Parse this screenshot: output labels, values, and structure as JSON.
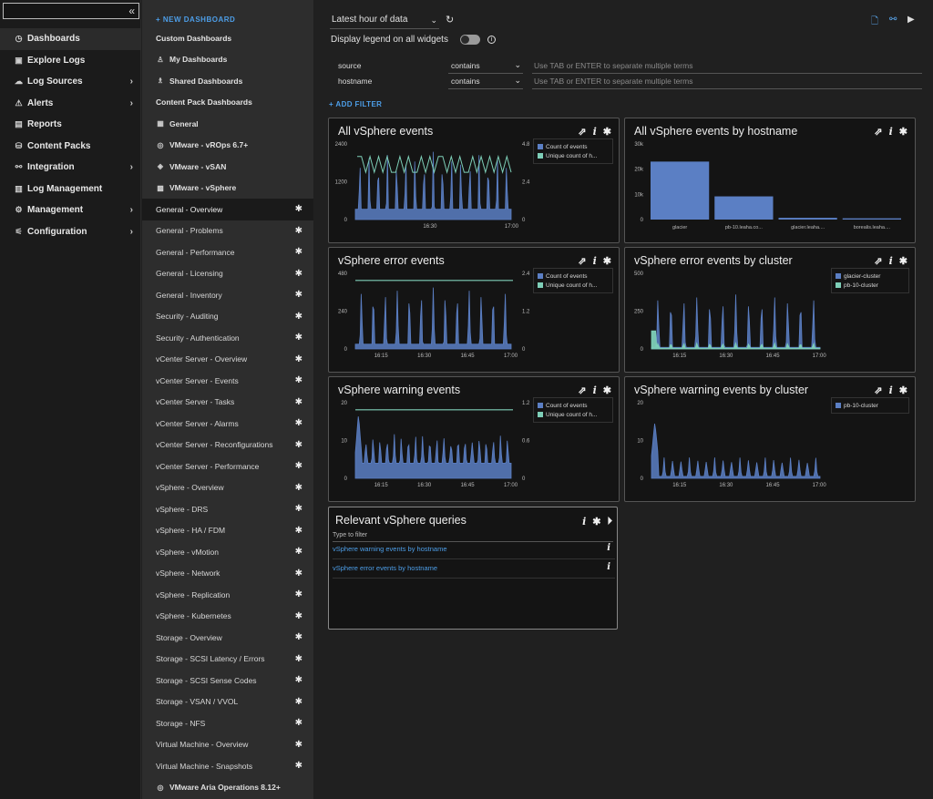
{
  "leftnav": {
    "search_value": "",
    "collapse_glyph": "«",
    "items": [
      {
        "label": "Dashboards",
        "icon": "dashboard-icon",
        "glyph": "◷",
        "active": true,
        "chevron": false
      },
      {
        "label": "Explore Logs",
        "icon": "explore-icon",
        "glyph": "▣",
        "active": false,
        "chevron": false
      },
      {
        "label": "Log Sources",
        "icon": "log-sources-icon",
        "glyph": "☁",
        "active": false,
        "chevron": true
      },
      {
        "label": "Alerts",
        "icon": "alert-icon",
        "glyph": "⚠",
        "active": false,
        "chevron": true
      },
      {
        "label": "Reports",
        "icon": "report-icon",
        "glyph": "▤",
        "active": false,
        "chevron": false
      },
      {
        "label": "Content Packs",
        "icon": "content-pack-icon",
        "glyph": "⛁",
        "active": false,
        "chevron": false
      },
      {
        "label": "Integration",
        "icon": "integration-icon",
        "glyph": "⚯",
        "active": false,
        "chevron": true
      },
      {
        "label": "Log Management",
        "icon": "log-management-icon",
        "glyph": "▥",
        "active": false,
        "chevron": false
      },
      {
        "label": "Management",
        "icon": "management-icon",
        "glyph": "⚙",
        "active": false,
        "chevron": true
      },
      {
        "label": "Configuration",
        "icon": "configuration-icon",
        "glyph": "⚟",
        "active": false,
        "chevron": true
      }
    ]
  },
  "dashlist": {
    "new_dashboard": "+ NEW DASHBOARD",
    "rows": [
      {
        "label": "Custom Dashboards",
        "kind": "head"
      },
      {
        "label": "My Dashboards",
        "kind": "sub",
        "icon": "user-icon",
        "glyph": "♙"
      },
      {
        "label": "Shared Dashboards",
        "kind": "sub",
        "icon": "users-icon",
        "glyph": "♗"
      },
      {
        "label": "Content Pack Dashboards",
        "kind": "head"
      },
      {
        "label": "General",
        "kind": "sub",
        "icon": "pack-icon",
        "glyph": "▦"
      },
      {
        "label": "VMware - vROps 6.7+",
        "kind": "sub",
        "icon": "vrops-icon",
        "glyph": "◎"
      },
      {
        "label": "VMware - vSAN",
        "kind": "sub",
        "icon": "vsan-icon",
        "glyph": "◈"
      },
      {
        "label": "VMware - vSphere",
        "kind": "sub",
        "icon": "vsphere-icon",
        "glyph": "▩"
      },
      {
        "label": "General - Overview",
        "kind": "item",
        "active": true
      },
      {
        "label": "General - Problems",
        "kind": "item"
      },
      {
        "label": "General - Performance",
        "kind": "item"
      },
      {
        "label": "General - Licensing",
        "kind": "item"
      },
      {
        "label": "General - Inventory",
        "kind": "item"
      },
      {
        "label": "Security - Auditing",
        "kind": "item"
      },
      {
        "label": "Security - Authentication",
        "kind": "item"
      },
      {
        "label": "vCenter Server - Overview",
        "kind": "item"
      },
      {
        "label": "vCenter Server - Events",
        "kind": "item"
      },
      {
        "label": "vCenter Server - Tasks",
        "kind": "item"
      },
      {
        "label": "vCenter Server - Alarms",
        "kind": "item"
      },
      {
        "label": "vCenter Server - Reconfigurations",
        "kind": "item"
      },
      {
        "label": "vCenter Server - Performance",
        "kind": "item"
      },
      {
        "label": "vSphere - Overview",
        "kind": "item"
      },
      {
        "label": "vSphere - DRS",
        "kind": "item"
      },
      {
        "label": "vSphere - HA / FDM",
        "kind": "item"
      },
      {
        "label": "vSphere - vMotion",
        "kind": "item"
      },
      {
        "label": "vSphere - Network",
        "kind": "item"
      },
      {
        "label": "vSphere - Replication",
        "kind": "item"
      },
      {
        "label": "vSphere - Kubernetes",
        "kind": "item"
      },
      {
        "label": "Storage - Overview",
        "kind": "item"
      },
      {
        "label": "Storage - SCSI Latency / Errors",
        "kind": "item"
      },
      {
        "label": "Storage - SCSI Sense Codes",
        "kind": "item"
      },
      {
        "label": "Storage - VSAN / VVOL",
        "kind": "item"
      },
      {
        "label": "Storage - NFS",
        "kind": "item"
      },
      {
        "label": "Virtual Machine - Overview",
        "kind": "item"
      },
      {
        "label": "Virtual Machine - Snapshots",
        "kind": "item"
      },
      {
        "label": "VMware Aria Operations 8.12+",
        "kind": "sub",
        "icon": "aria-icon",
        "glyph": "◎"
      }
    ]
  },
  "toolbar": {
    "time_range": "Latest hour of data",
    "legend_label": "Display legend on all widgets",
    "legend_toggle_on": false
  },
  "filters": [
    {
      "field": "source",
      "operator": "contains",
      "placeholder": "Use TAB or ENTER to separate multiple terms"
    },
    {
      "field": "hostname",
      "operator": "contains",
      "placeholder": "Use TAB or ENTER to separate multiple terms"
    }
  ],
  "add_filter": "+ ADD FILTER",
  "colors": {
    "count": "#5b7fc4",
    "unique": "#7ecfb8",
    "accent": "#4d9ee8"
  },
  "widgets": [
    {
      "title": "All vSphere events",
      "legend": [
        "Count of events",
        "Unique count of h..."
      ],
      "chart_data": {
        "type": "area",
        "x_ticks": [
          "16:30",
          "17:00"
        ],
        "y_ticks": [
          "0",
          "1200",
          "2400"
        ],
        "y2_ticks": [
          "0",
          "2.4",
          "4.8"
        ],
        "ylim": [
          0,
          2400
        ],
        "y2lim": [
          0,
          4.8
        ],
        "series": [
          {
            "name": "Count of events",
            "kind": "spiky-area",
            "base": 330,
            "peak": 2150,
            "spikes": 17
          },
          {
            "name": "Unique count of h...",
            "kind": "step-line",
            "values": [
              4,
              4,
              3,
              4,
              3,
              4,
              3,
              4,
              3,
              3,
              4,
              3,
              4,
              3,
              3,
              4,
              3,
              4,
              3,
              4,
              4,
              3,
              4,
              3,
              4,
              3,
              3,
              4,
              3,
              4,
              3,
              4,
              3,
              4,
              3,
              4,
              3
            ]
          }
        ]
      }
    },
    {
      "title": "All vSphere events by hostname",
      "legend": [],
      "chart_data": {
        "type": "bar",
        "categories": [
          "glacier",
          "pb-10.leaha.co...",
          "glacier.leaha....",
          "borealis.leaha...."
        ],
        "values": [
          23000,
          9200,
          700,
          500
        ],
        "y_ticks": [
          "0",
          "10k",
          "20k",
          "30k"
        ],
        "ylim": [
          0,
          30000
        ]
      }
    },
    {
      "title": "vSphere error events",
      "legend": [
        "Count of events",
        "Unique count of h..."
      ],
      "chart_data": {
        "type": "area",
        "x_ticks": [
          "16:15",
          "16:30",
          "16:45",
          "17:00"
        ],
        "y_ticks": [
          "0",
          "240",
          "480"
        ],
        "y2_ticks": [
          "0",
          "1.2",
          "2.4"
        ],
        "ylim": [
          0,
          480
        ],
        "y2lim": [
          0,
          2.4
        ],
        "series": [
          {
            "name": "Count of events",
            "kind": "spiky-area",
            "base": 30,
            "peak": 390,
            "spikes": 13
          },
          {
            "name": "Unique count of h...",
            "kind": "flat-line",
            "value": 2
          }
        ]
      }
    },
    {
      "title": "vSphere error events by cluster",
      "legend": [
        "glacier-cluster",
        "pb-10-cluster"
      ],
      "chart_data": {
        "type": "area",
        "x_ticks": [
          "16:15",
          "16:30",
          "16:45",
          "17:00"
        ],
        "y_ticks": [
          "0",
          "250",
          "500"
        ],
        "ylim": [
          0,
          500
        ],
        "series": [
          {
            "name": "glacier-cluster",
            "kind": "spiky-area",
            "base": 10,
            "peak": 360,
            "spikes": 13
          },
          {
            "name": "pb-10-cluster",
            "kind": "low-area",
            "base": 5,
            "peak": 40,
            "spikes": 13
          }
        ]
      }
    },
    {
      "title": "vSphere warning events",
      "legend": [
        "Count of events",
        "Unique count of h..."
      ],
      "chart_data": {
        "type": "area",
        "x_ticks": [
          "16:15",
          "16:30",
          "16:45",
          "17:00"
        ],
        "y_ticks": [
          "0",
          "10",
          "20"
        ],
        "y2_ticks": [
          "0",
          "0.6",
          "1.2"
        ],
        "ylim": [
          0,
          20
        ],
        "y2lim": [
          0,
          1.2
        ],
        "series": [
          {
            "name": "Count of events",
            "kind": "noisy-area",
            "base": 4,
            "peak": 8,
            "first_peak": 17,
            "spikes": 22
          },
          {
            "name": "Unique count of h...",
            "kind": "flat-line",
            "value": 1
          }
        ]
      }
    },
    {
      "title": "vSphere warning events by cluster",
      "legend": [
        "pb-10-cluster"
      ],
      "chart_data": {
        "type": "area",
        "x_ticks": [
          "16:15",
          "16:30",
          "16:45",
          "17:00"
        ],
        "y_ticks": [
          "0",
          "10",
          "20"
        ],
        "ylim": [
          0,
          20
        ],
        "series": [
          {
            "name": "pb-10-cluster",
            "kind": "noisy-area",
            "base": 0.5,
            "peak": 5,
            "first_peak": 15,
            "spikes": 20
          }
        ]
      }
    }
  ],
  "queries": {
    "title": "Relevant vSphere queries",
    "filter_placeholder": "Type to filter",
    "items": [
      "vSphere warning events by hostname",
      "vSphere error events by hostname"
    ]
  }
}
